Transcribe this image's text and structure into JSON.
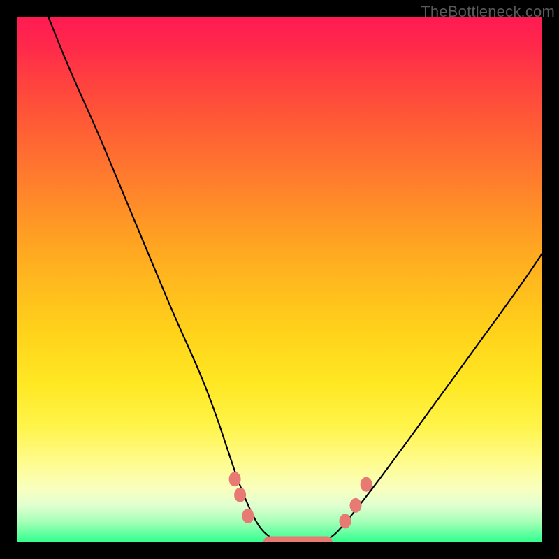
{
  "watermark": "TheBottleneck.com",
  "chart_data": {
    "type": "line",
    "title": "",
    "xlabel": "",
    "ylabel": "",
    "xlim": [
      0,
      100
    ],
    "ylim": [
      0,
      100
    ],
    "grid": false,
    "legend": false,
    "series": [
      {
        "name": "bottleneck-curve",
        "x": [
          6,
          10,
          15,
          20,
          25,
          30,
          35,
          38,
          40,
          42,
          44,
          46,
          48,
          50,
          52,
          54,
          56,
          58,
          60,
          62,
          66,
          72,
          80,
          88,
          96,
          100
        ],
        "y": [
          100,
          90,
          79,
          67,
          55,
          43,
          32,
          24,
          18,
          12,
          7,
          3,
          1,
          0,
          0,
          0,
          0,
          0,
          1,
          3,
          8,
          16,
          27,
          38,
          49,
          55
        ]
      }
    ],
    "markers": [
      {
        "name": "left-upper-dot",
        "x": 41.5,
        "y": 12
      },
      {
        "name": "left-mid-dot",
        "x": 42.5,
        "y": 9
      },
      {
        "name": "left-lower-dot",
        "x": 44.0,
        "y": 5
      },
      {
        "name": "bottom-pill",
        "x0": 47,
        "x1": 60,
        "y": 0
      },
      {
        "name": "right-lower-dot",
        "x": 62.5,
        "y": 4
      },
      {
        "name": "right-mid-dot",
        "x": 64.5,
        "y": 7
      },
      {
        "name": "right-upper-dot",
        "x": 66.5,
        "y": 11
      }
    ],
    "gradient_colors": {
      "top": "#ff1a52",
      "mid": "#ffe824",
      "bottom": "#30ff90"
    }
  }
}
